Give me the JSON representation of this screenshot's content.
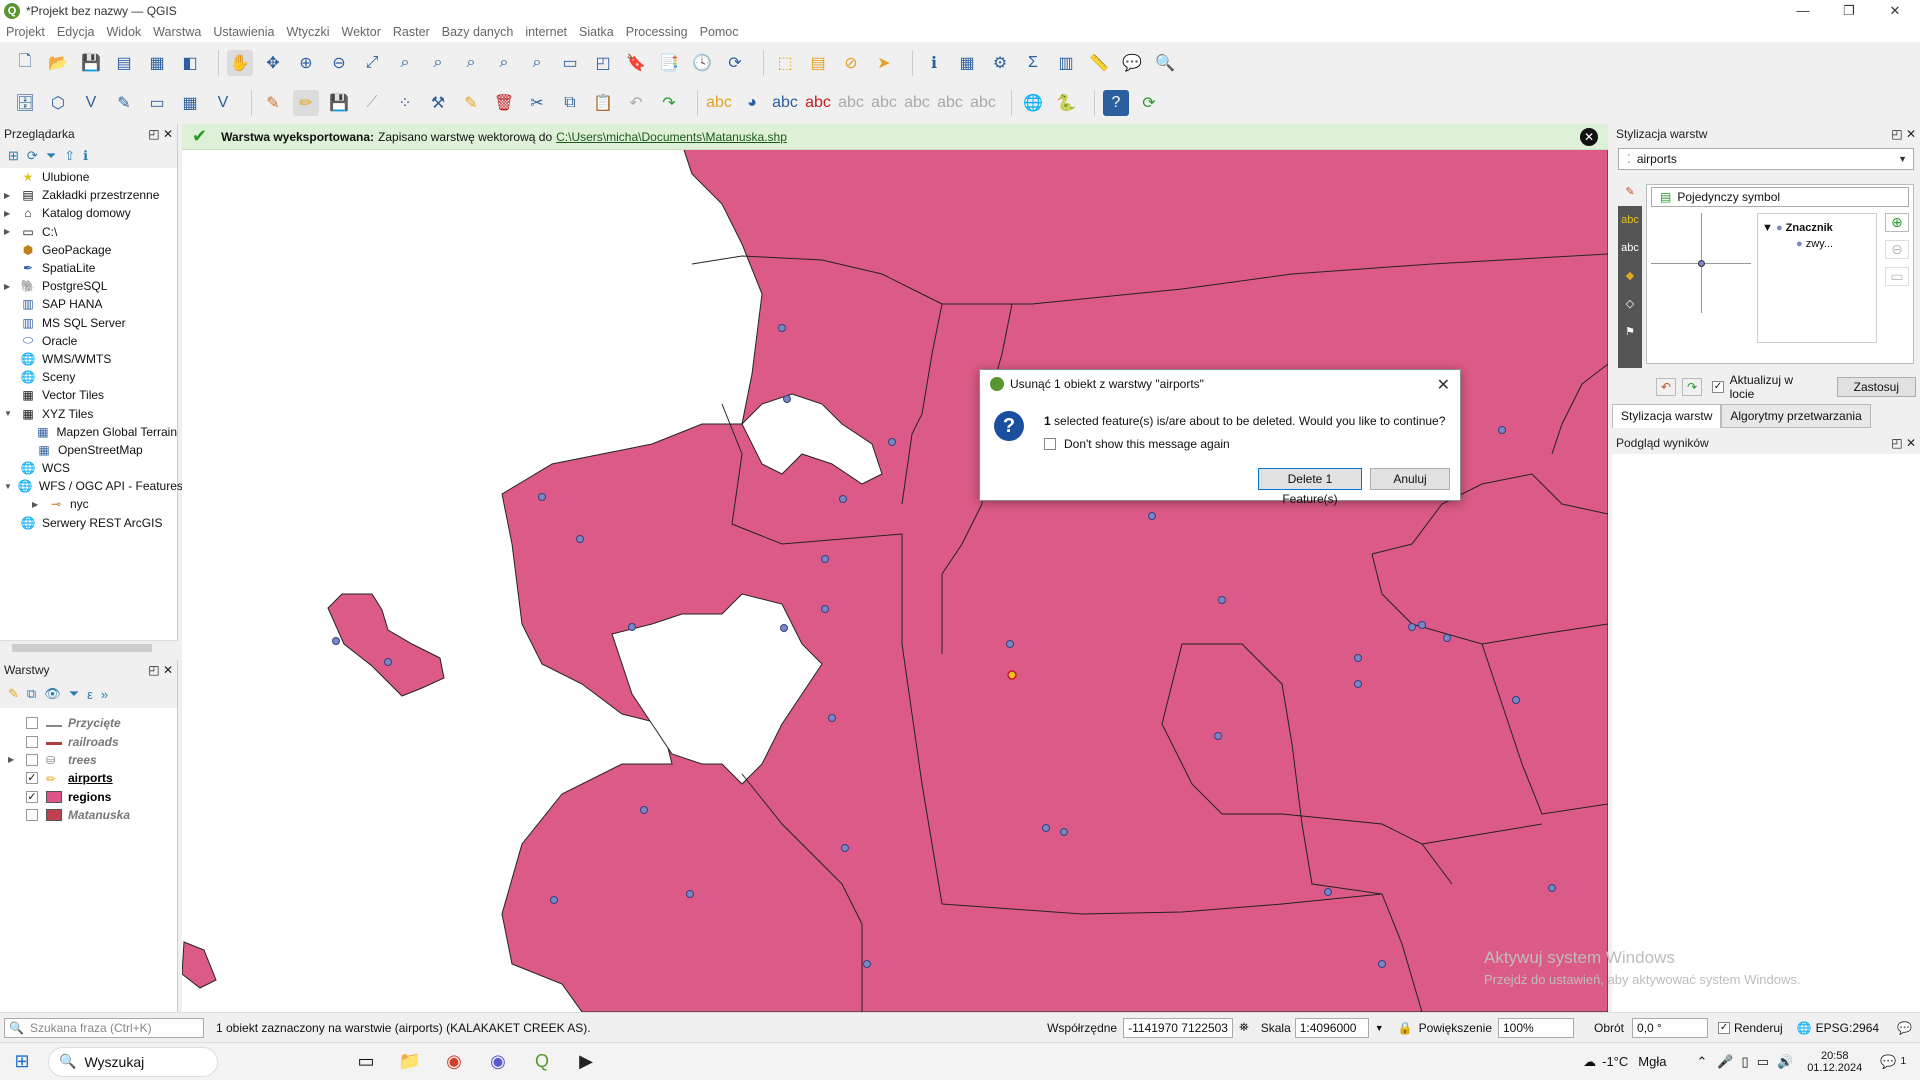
{
  "window": {
    "title": "*Projekt bez nazwy — QGIS",
    "logo": "Q",
    "minimize": "—",
    "restore": "❐",
    "close": "✕"
  },
  "menu": [
    "Projekt",
    "Edycja",
    "Widok",
    "Warstwa",
    "Ustawienia",
    "Wtyczki",
    "Wektor",
    "Raster",
    "Bazy danych",
    "internet",
    "Siatka",
    "Processing",
    "Pomoc"
  ],
  "message_bar": {
    "bold": "Warstwa wyeksportowana:",
    "text": "Zapisano warstwę wektorową do",
    "link": "C:\\Users\\micha\\Documents\\Matanuska.shp"
  },
  "browser": {
    "title": "Przeglądarka",
    "items": [
      {
        "label": "Ulubione",
        "icon": "star-icon"
      },
      {
        "label": "Zakładki przestrzenne",
        "icon": "bookmark-icon"
      },
      {
        "label": "Katalog domowy",
        "icon": "home-folder-icon"
      },
      {
        "label": "C:\\",
        "icon": "drive-icon"
      },
      {
        "label": "GeoPackage",
        "icon": "geopackage-icon"
      },
      {
        "label": "SpatiaLite",
        "icon": "spatialite-icon"
      },
      {
        "label": "PostgreSQL",
        "icon": "postgresql-icon"
      },
      {
        "label": "SAP HANA",
        "icon": "sap-hana-icon"
      },
      {
        "label": "MS SQL Server",
        "icon": "mssql-icon"
      },
      {
        "label": "Oracle",
        "icon": "oracle-icon"
      },
      {
        "label": "WMS/WMTS",
        "icon": "wms-icon"
      },
      {
        "label": "Sceny",
        "icon": "scenes-icon"
      },
      {
        "label": "Vector Tiles",
        "icon": "vector-tiles-icon"
      },
      {
        "label": "XYZ Tiles",
        "icon": "xyz-tiles-icon"
      },
      {
        "label": "Mapzen Global Terrain",
        "icon": "tiles-icon"
      },
      {
        "label": "OpenStreetMap",
        "icon": "tiles-icon"
      },
      {
        "label": "WCS",
        "icon": "wcs-icon"
      },
      {
        "label": "WFS / OGC API - Features",
        "icon": "wfs-icon"
      },
      {
        "label": "nyc",
        "icon": "connection-icon"
      },
      {
        "label": "Serwery REST ArcGIS",
        "icon": "arcgis-icon"
      }
    ]
  },
  "layers": {
    "title": "Warstwy",
    "items": [
      {
        "name": "Przycięte",
        "checked": false,
        "color": "#888888",
        "style": "dim"
      },
      {
        "name": "railroads",
        "checked": false,
        "color": "#b04040",
        "style": "dim"
      },
      {
        "name": "trees",
        "checked": false,
        "color": "#999999",
        "style": "dim"
      },
      {
        "name": "airports",
        "checked": true,
        "color": "#e8b020",
        "style": "bold"
      },
      {
        "name": "regions",
        "checked": true,
        "color": "#e05585",
        "style": "bold"
      },
      {
        "name": "Matanuska",
        "checked": false,
        "color": "#c04050",
        "style": "dim"
      }
    ]
  },
  "dialog": {
    "title": "Usunąć 1 obiekt z warstwy \"airports\"",
    "count": "1",
    "message": "selected feature(s) is/are about to be deleted. Would you like to continue?",
    "checkbox": "Don't show this message again",
    "delete_btn": "Delete 1 Feature(s)",
    "cancel_btn": "Anuluj"
  },
  "style_panel": {
    "title": "Stylizacja warstw",
    "layer": "airports",
    "renderer": "Pojedynczy symbol",
    "symbol_root": "Znacznik",
    "symbol_child": "zwy...",
    "live_update": "Aktualizuj w locie",
    "apply": "Zastosuj",
    "tab1": "Stylizacja warstw",
    "tab2": "Algorytmy przetwarzania"
  },
  "results_panel": {
    "title": "Podgląd wyników"
  },
  "watermark": {
    "line1": "Aktywuj system Windows",
    "line2": "Przejdź do ustawień, aby aktywować system Windows."
  },
  "statusbar": {
    "search_placeholder": "Szukana fraza (Ctrl+K)",
    "selection": "1 obiekt zaznaczony na warstwie (airports) (KALAKAKET CREEK AS).",
    "coord_label": "Współrzędne",
    "coord_value": "-1141970  7122503",
    "scale_label": "Skala",
    "scale_value": "1:4096000",
    "magnifier_label": "Powiększenie",
    "magnifier_value": "100%",
    "rotation_label": "Obrót",
    "rotation_value": "0,0 °",
    "render_label": "Renderuj",
    "crs": "EPSG:2964"
  },
  "taskbar": {
    "search": "Wyszukaj",
    "weather_temp": "-1°C",
    "weather_desc": "Mgła",
    "time": "20:58",
    "date": "01.12.2024",
    "notif": "1"
  },
  "colors": {
    "region_fill": "#dc5a87",
    "region_stroke": "#232323",
    "airport_point": "#7a86c6",
    "selected_point": "#f0c020",
    "accent": "#589632"
  }
}
